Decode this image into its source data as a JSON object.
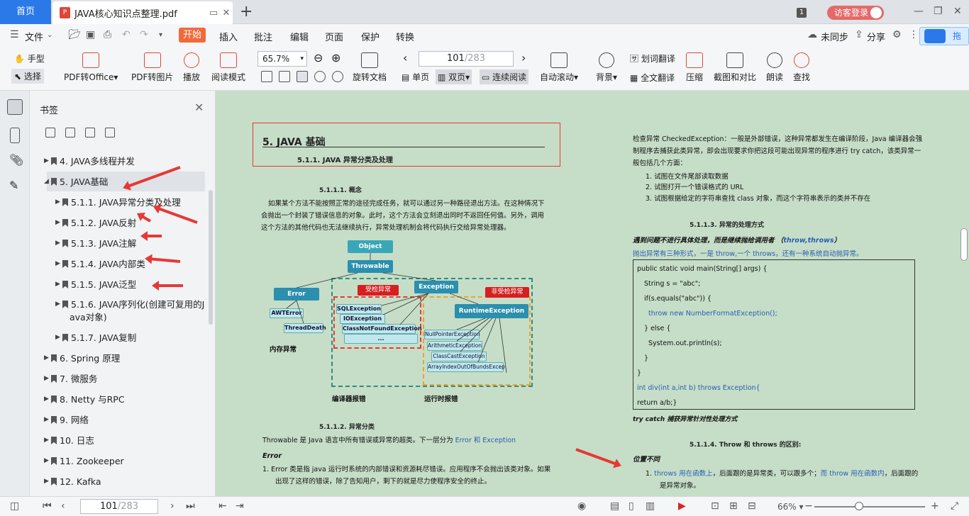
{
  "tabs": {
    "home": "首页",
    "doc": "JAVA核心知识点整理.pdf",
    "login": "访客登录",
    "badge": "1"
  },
  "menu": {
    "file": "文件",
    "items": [
      "开始",
      "插入",
      "批注",
      "编辑",
      "页面",
      "保护",
      "转换"
    ],
    "sync": "未同步",
    "share": "分享",
    "drag": "拖拽"
  },
  "toolbar": {
    "hand": "手型",
    "select": "选择",
    "pdf_office": "PDF转Office",
    "pdf_image": "PDF转图片",
    "play": "播放",
    "read_mode": "阅读模式",
    "zoom": "65.7%",
    "rotate": "旋转文档",
    "page_current": "101",
    "page_total": "/283",
    "single": "单页",
    "double": "双页",
    "continuous": "连续阅读",
    "autoscroll": "自动滚动",
    "bg": "背景",
    "word_translate": "划词翻译",
    "full_translate": "全文翻译",
    "compress": "压缩",
    "screenshot": "截图和对比",
    "read_aloud": "朗读",
    "find": "查找"
  },
  "bookmarks": {
    "title": "书签",
    "items": [
      {
        "label": "4. JAVA多线程并发",
        "level": 0
      },
      {
        "label": "5. JAVA基础",
        "level": 0
      },
      {
        "label": "5.1.1. JAVA异常分类及处理",
        "level": 1
      },
      {
        "label": "5.1.2. JAVA反射",
        "level": 1
      },
      {
        "label": "5.1.3. JAVA注解",
        "level": 1
      },
      {
        "label": "5.1.4. JAVA内部类",
        "level": 1
      },
      {
        "label": "5.1.5. JAVA泛型",
        "level": 1
      },
      {
        "label": "5.1.6. JAVA序列化(创建可复用的J",
        "level": 1
      },
      {
        "label": "ava对象)",
        "level": 1
      },
      {
        "label": "5.1.7. JAVA复制",
        "level": 1
      },
      {
        "label": "6. Spring 原理",
        "level": 0
      },
      {
        "label": "7.    微服务",
        "level": 0
      },
      {
        "label": "8. Netty 与RPC",
        "level": 0
      },
      {
        "label": "9. 网络",
        "level": 0
      },
      {
        "label": "10. 日志",
        "level": 0
      },
      {
        "label": "11. Zookeeper",
        "level": 0
      },
      {
        "label": "12. Kafka",
        "level": 0
      }
    ]
  },
  "left_page": {
    "h1": "5. JAVA 基础",
    "h2_1": "5.1.1.  JAVA 异常分类及处理",
    "h3_1": "5.1.1.1.      概念",
    "p1": "如果某个方法不能按照正常的途径完成任务，就可以通过另一种路径退出方法。在这种情况下",
    "p2": "会抛出一个封装了错误信息的对象。此时，这个方法会立刻退出同时不返回任何值。另外，调用",
    "p3": "这个方法的其他代码也无法继续执行，异常处理机制会将代码执行交给异常处理器。",
    "diagram": {
      "object": "Object",
      "throwable": "Throwable",
      "error": "Error",
      "exception": "Exception",
      "awterror": "AWTError",
      "threaddeath": "ThreadDeath",
      "checked": "受检异常",
      "unchecked": "非受检异常",
      "sqlexc": "SQLException",
      "ioexc": "IOException",
      "cnfexc": "ClassNotFoundException",
      "dots": "...",
      "runtime": "RuntimeException",
      "npe": "NullPointerException",
      "arith": "ArithmeticException",
      "cce": "ClassCastException",
      "aioobe": "ArrayIndexOutOfBundsExcep",
      "mem": "内存异常",
      "compile": "编译器报错",
      "runtime_err": "运行时报错"
    },
    "h3_2": "5.1.1.2.      异常分类",
    "p4a": "Throwable 是 Java 语言中所有错误或异常的超类。下一层分为 ",
    "p4b": "Error 和 Exception",
    "error_title": "Error",
    "e1": "1.    Error 类是指 java 运行时系统的内部错误和资源耗尽错误。应用程序不会抛出该类对象。如果",
    "e2": "出现了这样的错误，除了告知用户，剩下的就是尽力使程序安全的终止。"
  },
  "right_page": {
    "c1": "检查异常 CheckedException：一般是外部错误，这种异常都发生在编译阶段，Java 编译器会强",
    "c2": "制程序去捕获此类异常，即会出现要求你把这段可能出现异常的程序进行 try catch，该类异常一",
    "c3": "般包括几个方面：",
    "l1": "1.    试图在文件尾部读取数据",
    "l2": "2.    试图打开一个错误格式的 URL",
    "l3": "3.    试图根据给定的字符串查找 class 对象，而这个字符串表示的类并不存在",
    "h3": "5.1.1.3.      异常的处理方式",
    "t1a": "遇到问题不进行具体处理，而是继续抛给调用者 （",
    "t1b": "throw,throws",
    "t1c": "）",
    "t2": "抛出异常有三种形式，一是 throw,一个 throws，还有一种系统自动抛异常。",
    "code": [
      "public static void main(String[] args) {",
      "String s = \"abc\";",
      "if(s.equals(\"abc\")) {",
      "throw new NumberFormatException();",
      "} else {",
      "System.out.println(s);",
      "}",
      "}",
      "int div(int a,int b) throws Exception{",
      "return a/b;}"
    ],
    "trycatch": "try catch 捕获异常针对性处理方式",
    "h3b": "5.1.1.4.      Throw 和 throws 的区别:",
    "pos": "位置不同",
    "d1a": "1.    ",
    "d1b": "throws 用在函数上",
    "d1c": "，后面跟的是异常类，可以跟多个；",
    "d1d": "而 throw 用在函数内",
    "d1e": "，后面跟的",
    "d2": "是异常对象。"
  },
  "status": {
    "page_current": "101",
    "page_total": "/283",
    "zoom": "66%"
  }
}
